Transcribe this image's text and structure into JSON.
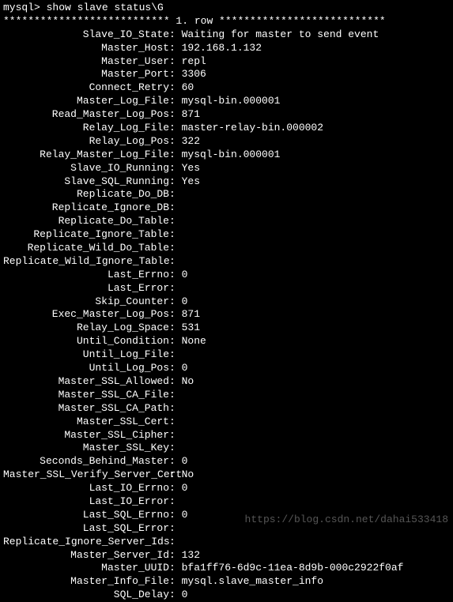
{
  "prompt": "mysql> show slave status\\G",
  "row_header": "*************************** 1. row ***************************",
  "fields": [
    {
      "label": "Slave_IO_State",
      "value": "Waiting for master to send event"
    },
    {
      "label": "Master_Host",
      "value": "192.168.1.132"
    },
    {
      "label": "Master_User",
      "value": "repl"
    },
    {
      "label": "Master_Port",
      "value": "3306"
    },
    {
      "label": "Connect_Retry",
      "value": "60"
    },
    {
      "label": "Master_Log_File",
      "value": "mysql-bin.000001"
    },
    {
      "label": "Read_Master_Log_Pos",
      "value": "871"
    },
    {
      "label": "Relay_Log_File",
      "value": "master-relay-bin.000002"
    },
    {
      "label": "Relay_Log_Pos",
      "value": "322"
    },
    {
      "label": "Relay_Master_Log_File",
      "value": "mysql-bin.000001"
    },
    {
      "label": "Slave_IO_Running",
      "value": "Yes"
    },
    {
      "label": "Slave_SQL_Running",
      "value": "Yes"
    },
    {
      "label": "Replicate_Do_DB",
      "value": ""
    },
    {
      "label": "Replicate_Ignore_DB",
      "value": ""
    },
    {
      "label": "Replicate_Do_Table",
      "value": ""
    },
    {
      "label": "Replicate_Ignore_Table",
      "value": ""
    },
    {
      "label": "Replicate_Wild_Do_Table",
      "value": ""
    },
    {
      "label": "Replicate_Wild_Ignore_Table",
      "value": ""
    },
    {
      "label": "Last_Errno",
      "value": "0"
    },
    {
      "label": "Last_Error",
      "value": ""
    },
    {
      "label": "Skip_Counter",
      "value": "0"
    },
    {
      "label": "Exec_Master_Log_Pos",
      "value": "871"
    },
    {
      "label": "Relay_Log_Space",
      "value": "531"
    },
    {
      "label": "Until_Condition",
      "value": "None"
    },
    {
      "label": "Until_Log_File",
      "value": ""
    },
    {
      "label": "Until_Log_Pos",
      "value": "0"
    },
    {
      "label": "Master_SSL_Allowed",
      "value": "No"
    },
    {
      "label": "Master_SSL_CA_File",
      "value": ""
    },
    {
      "label": "Master_SSL_CA_Path",
      "value": ""
    },
    {
      "label": "Master_SSL_Cert",
      "value": ""
    },
    {
      "label": "Master_SSL_Cipher",
      "value": ""
    },
    {
      "label": "Master_SSL_Key",
      "value": ""
    },
    {
      "label": "Seconds_Behind_Master",
      "value": "0"
    },
    {
      "label": "Master_SSL_Verify_Server_Cert",
      "value": "No"
    },
    {
      "label": "Last_IO_Errno",
      "value": "0"
    },
    {
      "label": "Last_IO_Error",
      "value": ""
    },
    {
      "label": "Last_SQL_Errno",
      "value": "0"
    },
    {
      "label": "Last_SQL_Error",
      "value": ""
    },
    {
      "label": "Replicate_Ignore_Server_Ids",
      "value": ""
    },
    {
      "label": "Master_Server_Id",
      "value": "132"
    },
    {
      "label": "Master_UUID",
      "value": "bfa1ff76-6d9c-11ea-8d9b-000c2922f0af"
    },
    {
      "label": "Master_Info_File",
      "value": "mysql.slave_master_info"
    },
    {
      "label": "SQL_Delay",
      "value": "0"
    }
  ],
  "watermark": "https://blog.csdn.net/dahai533418"
}
